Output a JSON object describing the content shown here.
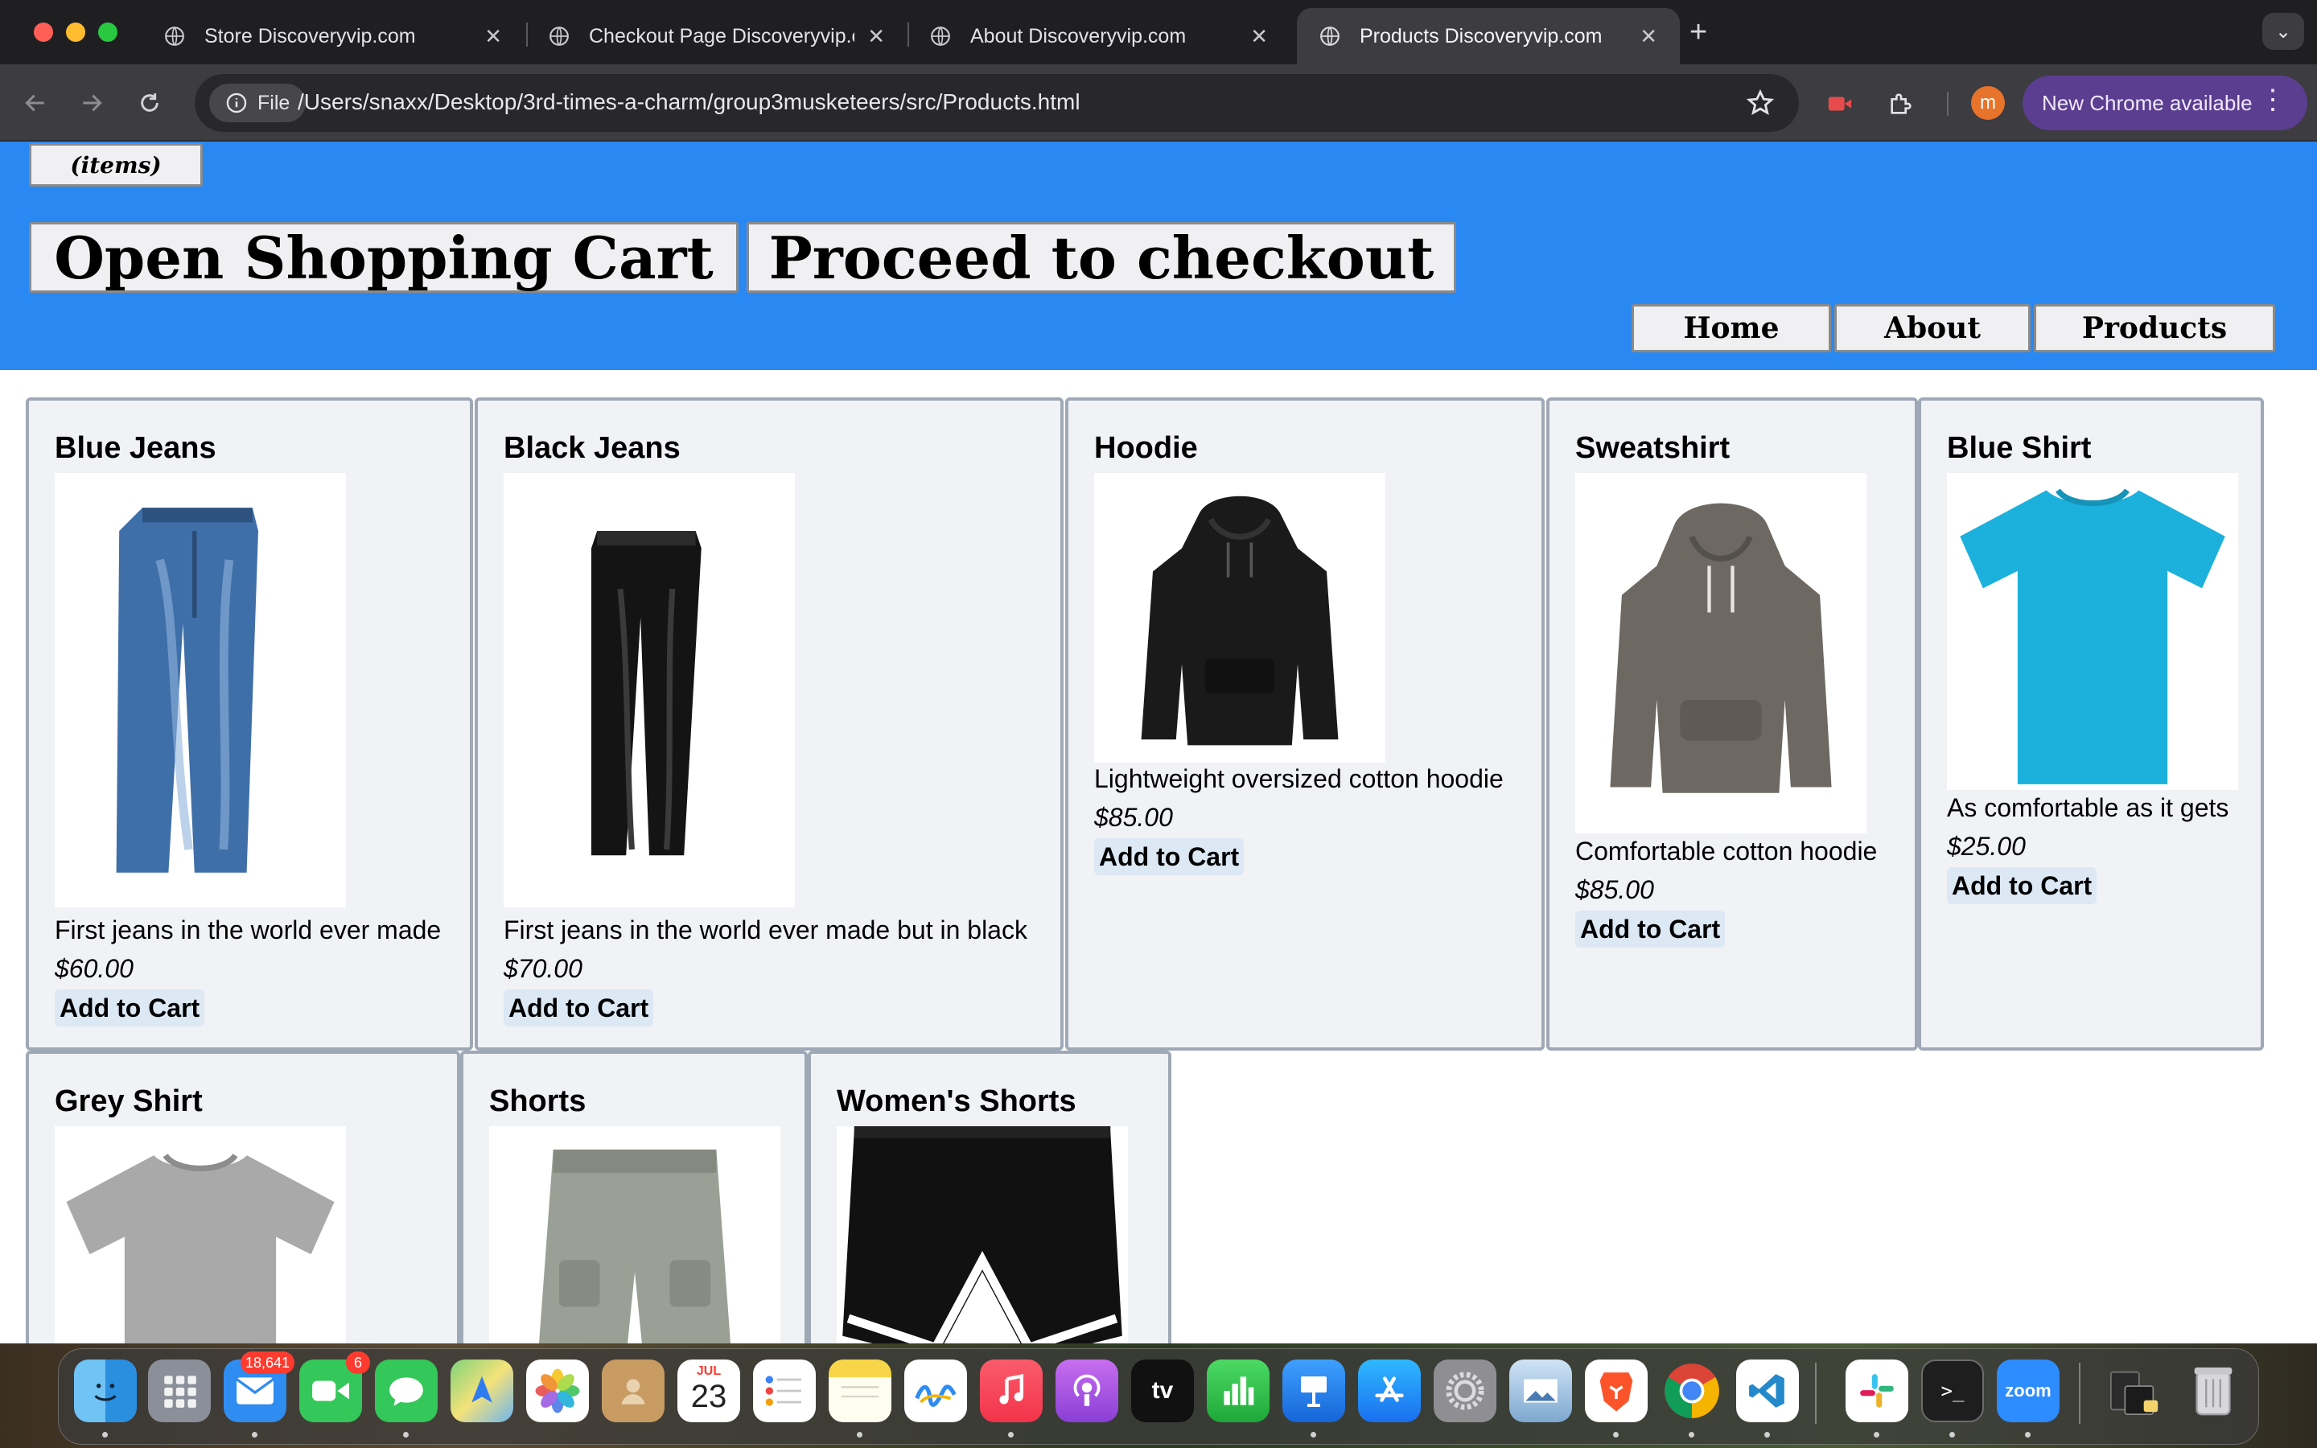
{
  "browser": {
    "tabs": [
      {
        "title": "Store Discoveryvip.com",
        "active": false
      },
      {
        "title": "Checkout Page Discoveryvip.com",
        "active": false
      },
      {
        "title": "About Discoveryvip.com",
        "active": false
      },
      {
        "title": "Products Discoveryvip.com",
        "active": true
      }
    ],
    "new_tab_label": "+",
    "tab_search_label": "⌄",
    "url_scheme_chip": "File",
    "url": "/Users/snaxx/Desktop/3rd-times-a-charm/group3musketeers/src/Products.html",
    "profile_initial": "m",
    "update_chip": "New Chrome available",
    "menu_label": "⋮"
  },
  "site": {
    "header": {
      "background": "#2a88f2",
      "cart_count_label": "(items)",
      "open_cart_label": "Open Shopping Cart",
      "checkout_label": "Proceed to checkout",
      "nav": [
        {
          "label": "Home"
        },
        {
          "label": "About"
        },
        {
          "label": "Products"
        }
      ]
    },
    "products": [
      {
        "name": "Blue Jeans",
        "description": "First jeans in the world ever made",
        "price": "$60.00",
        "button": "Add to Cart",
        "image": "blue-jeans-image"
      },
      {
        "name": "Black Jeans",
        "description": "First jeans in the world ever made but in black",
        "price": "$70.00",
        "button": "Add to Cart",
        "image": "black-jeans-image"
      },
      {
        "name": "Hoodie",
        "description": "Lightweight oversized cotton hoodie",
        "price": "$85.00",
        "button": "Add to Cart",
        "image": "black-hoodie-image"
      },
      {
        "name": "Sweatshirt",
        "description": "Comfortable cotton hoodie",
        "price": "$85.00",
        "button": "Add to Cart",
        "image": "grey-hoodie-image"
      },
      {
        "name": "Blue Shirt",
        "description": "As comfortable as it gets",
        "price": "$25.00",
        "button": "Add to Cart",
        "image": "blue-tshirt-image"
      },
      {
        "name": "Grey Shirt",
        "image": "grey-tshirt-image"
      },
      {
        "name": "Shorts",
        "image": "cargo-shorts-image"
      },
      {
        "name": "Women's Shorts",
        "image": "womens-shorts-image"
      }
    ]
  },
  "dock": {
    "mail_badge": "18,641",
    "facetime_badge": "6",
    "calendar_month": "JUL",
    "calendar_day": "23",
    "tv_label": "tv",
    "zoom_label": "zoom",
    "terminal_prompt": ">_",
    "apps": [
      "Finder",
      "Launchpad",
      "Mail",
      "FaceTime",
      "Messages",
      "Maps",
      "Photos",
      "Contacts",
      "Calendar",
      "Reminders",
      "Notes",
      "Freeform",
      "Music",
      "Podcasts",
      "TV",
      "Numbers",
      "Keynote",
      "App Store",
      "System Settings",
      "Preview",
      "Brave",
      "Chrome",
      "VS Code",
      "Slack",
      "Terminal",
      "Zoom",
      "Downloads",
      "Trash"
    ]
  }
}
